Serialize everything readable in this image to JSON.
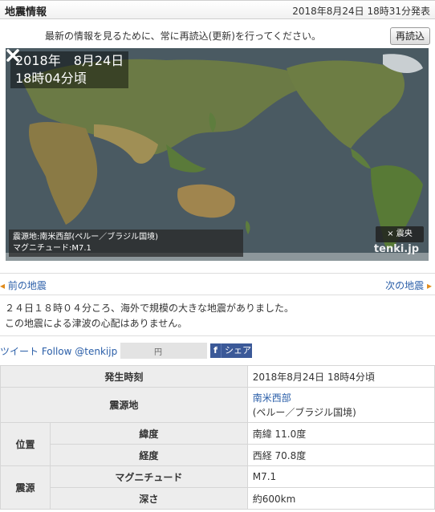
{
  "header": {
    "title": "地震情報",
    "issued": "2018年8月24日 18時31分発表"
  },
  "notice": {
    "text": "最新の情報を見るために、常に再読込(更新)を行ってください。",
    "reload_label": "再読込"
  },
  "map": {
    "date": "2018年　8月24日",
    "time": "18時04分頃",
    "epicenter_line": "震源地:南米西部(ペルー／ブラジル国境)",
    "magnitude_line": "マグニチュード:M7.1",
    "legend_label": "× 震央",
    "brand": "tenki.jp"
  },
  "nav": {
    "prev": "前の地震",
    "next": "次の地震"
  },
  "message": {
    "line1": "２４日１８時０４分ころ、海外で規模の大きな地震がありました。",
    "line2": "この地震による津波の心配はありません。"
  },
  "social": {
    "tweet": "ツイート Follow @tenkijp",
    "follow_placeholder": "円",
    "share_label": "シェア",
    "fb_letter": "f"
  },
  "table": {
    "time_label": "発生時刻",
    "time_value": "2018年8月24日 18時4分頃",
    "epicenter_label": "震源地",
    "epicenter_link": "南米西部",
    "epicenter_detail": "(ペルー／ブラジル国境)",
    "position_label": "位置",
    "lat_label": "緯度",
    "lat_value": "南緯 11.0度",
    "lon_label": "経度",
    "lon_value": "西経 70.8度",
    "source_label": "震源",
    "mag_label": "マグニチュード",
    "mag_value": "M7.1",
    "depth_label": "深さ",
    "depth_value": "約600km"
  },
  "colors": {
    "link": "#2a5ea8",
    "arrow": "#e08b1c",
    "facebook": "#3b5998"
  }
}
